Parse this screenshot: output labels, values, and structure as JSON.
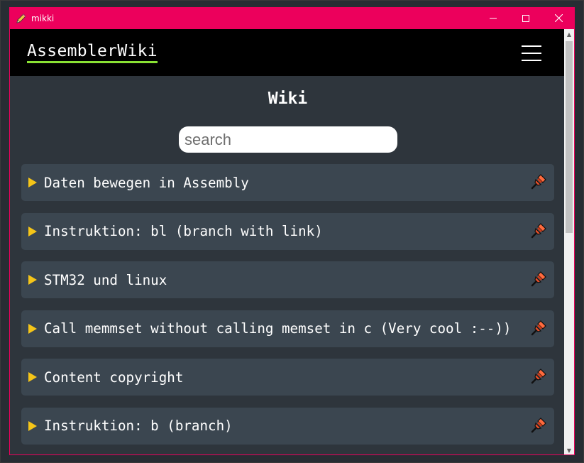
{
  "window": {
    "title": "mikki"
  },
  "header": {
    "brand": "AssemblerWiki"
  },
  "page": {
    "title": "Wiki"
  },
  "search": {
    "placeholder": "search"
  },
  "articles": [
    {
      "title": "Daten bewegen in Assembly"
    },
    {
      "title": "Instruktion: bl (branch with link)"
    },
    {
      "title": "STM32 und linux"
    },
    {
      "title": "Call memmset without calling memset in c (Very cool :--))"
    },
    {
      "title": "Content copyright"
    },
    {
      "title": "Instruktion: b (branch)"
    }
  ],
  "icons": {
    "window": "pencil-icon",
    "menu": "hamburger-icon",
    "toggle": "triangle-right-icon",
    "pin": "pushpin-icon"
  },
  "colors": {
    "titlebar": "#ec005c",
    "header": "#000000",
    "underline": "#8ae234",
    "background": "#2e353c",
    "item": "#3b4650",
    "arrow": "#f5c518"
  }
}
